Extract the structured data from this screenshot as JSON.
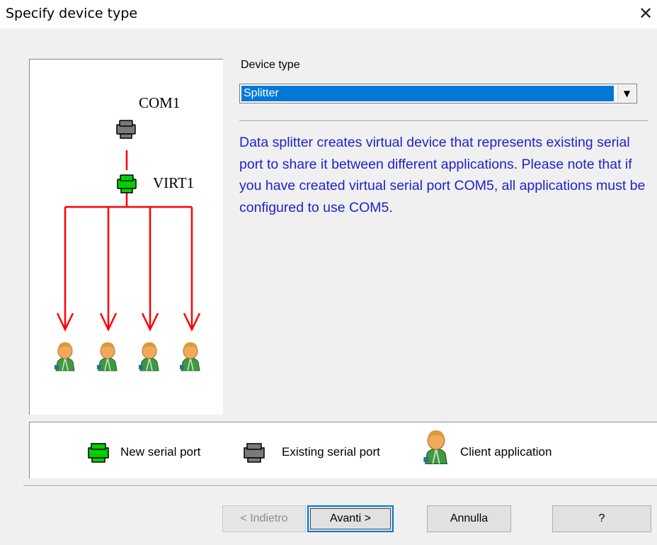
{
  "window": {
    "title": "Specify device type",
    "close_icon": "close-icon"
  },
  "diagram": {
    "existing_port_label": "COM1",
    "virtual_port_label": "VIRT1",
    "client_count": 4,
    "colors": {
      "line": "#ff0000",
      "new_port": "#00c800",
      "existing_port": "#7a7a7a"
    }
  },
  "device_type": {
    "label": "Device type",
    "selected": "Splitter"
  },
  "description": "Data splitter creates virtual device that represents existing serial port to share it between different applications. Please note that if you have created virtual serial port COM5, all applications must be configured to use COM5.",
  "legend": {
    "new_port": "New serial port",
    "existing_port": "Existing serial port",
    "client_app": "Client application"
  },
  "buttons": {
    "back": "< Indietro",
    "next": "Avanti >",
    "cancel": "Annulla",
    "help": "?"
  }
}
